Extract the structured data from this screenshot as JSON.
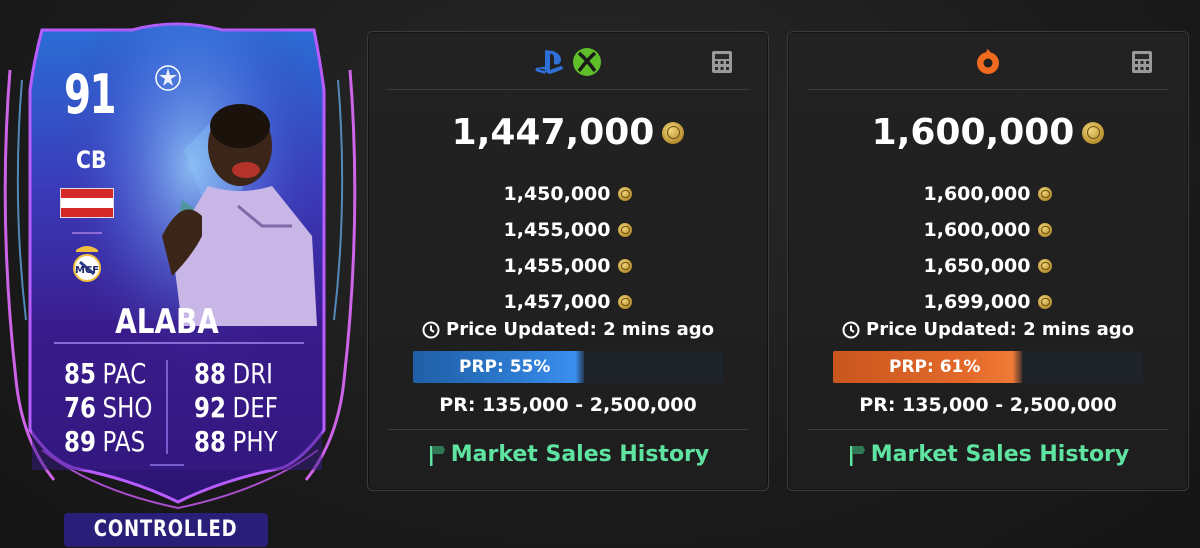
{
  "card": {
    "rating": "91",
    "position": "CB",
    "name": "ALABA",
    "stats_left": [
      {
        "value": "85",
        "label": "PAC"
      },
      {
        "value": "76",
        "label": "SHO"
      },
      {
        "value": "89",
        "label": "PAS"
      }
    ],
    "stats_right": [
      {
        "value": "88",
        "label": "DRI"
      },
      {
        "value": "92",
        "label": "DEF"
      },
      {
        "value": "88",
        "label": "PHY"
      }
    ],
    "controlled_label": "CONTROLLED",
    "colors": {
      "frame_glow": "#b85cff",
      "card_bg": "#3a1c8c",
      "flag_red": "#d42a2a",
      "flag_white": "#ffffff"
    }
  },
  "panels": [
    {
      "platform_icons": [
        "playstation-icon",
        "xbox-icon"
      ],
      "main_price": "1,447,000",
      "prices": [
        "1,450,000",
        "1,455,000",
        "1,455,000",
        "1,457,000"
      ],
      "updated_text": "Price Updated: 2 mins ago",
      "prp_label": "PRP: 55%",
      "prp_percent": 55,
      "pr_range": "PR: 135,000 - 2,500,000",
      "market_link": "Market Sales History",
      "accent": "#2d7ad0"
    },
    {
      "platform_icons": [
        "origin-icon"
      ],
      "main_price": "1,600,000",
      "prices": [
        "1,600,000",
        "1,600,000",
        "1,650,000",
        "1,699,000"
      ],
      "updated_text": "Price Updated: 2 mins ago",
      "prp_label": "PRP: 61%",
      "prp_percent": 61,
      "pr_range": "PR: 135,000 - 2,500,000",
      "market_link": "Market Sales History",
      "accent": "#e2692a"
    }
  ]
}
